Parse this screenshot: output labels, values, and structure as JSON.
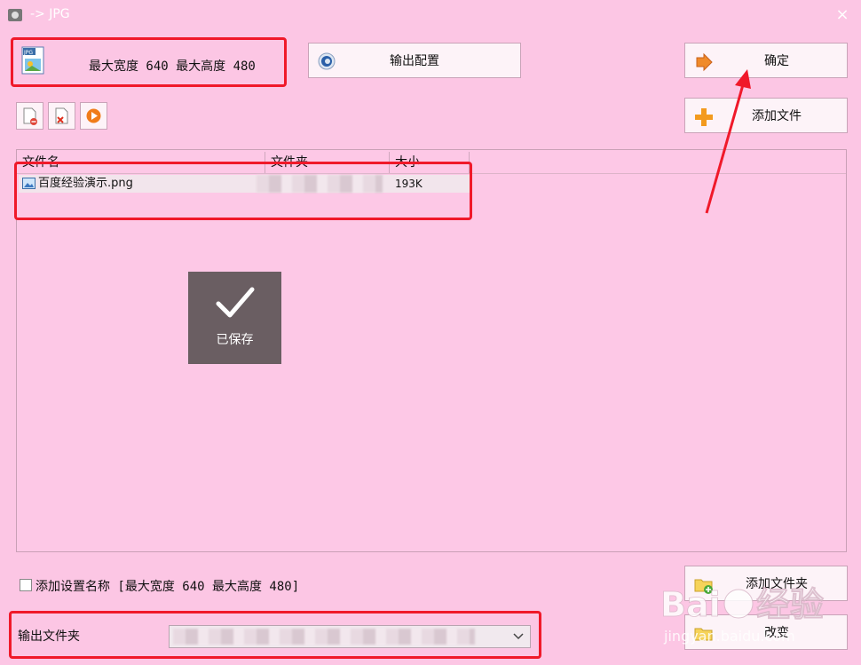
{
  "window": {
    "title": "-> JPG",
    "close_glyph": "×"
  },
  "preset": {
    "text": "最大宽度 640 最大高度 480",
    "icon": "jpg-file-icon"
  },
  "buttons": {
    "output_config": "输出配置",
    "ok": "确定",
    "add_file": "添加文件",
    "add_folder": "添加文件夹",
    "change": "改变"
  },
  "toolbar": [
    "remove-icon",
    "clear-icon",
    "play-icon"
  ],
  "file_list": {
    "columns": [
      "文件名",
      "文件夹",
      "大小"
    ],
    "rows": [
      {
        "name": "百度经验演示.png",
        "size": "193K"
      }
    ]
  },
  "toast": {
    "text": "已保存"
  },
  "options": {
    "add_name_label": "添加设置名称 [最大宽度 640 最大高度 480]",
    "checked": false
  },
  "output": {
    "label": "输出文件夹"
  },
  "watermark": {
    "text": "Bai du 经验",
    "subtext": "jingyan.baidu.com"
  },
  "colors": {
    "background": "#fcc6e4",
    "highlight": "#f0192a",
    "toast": "#6a5e62"
  }
}
